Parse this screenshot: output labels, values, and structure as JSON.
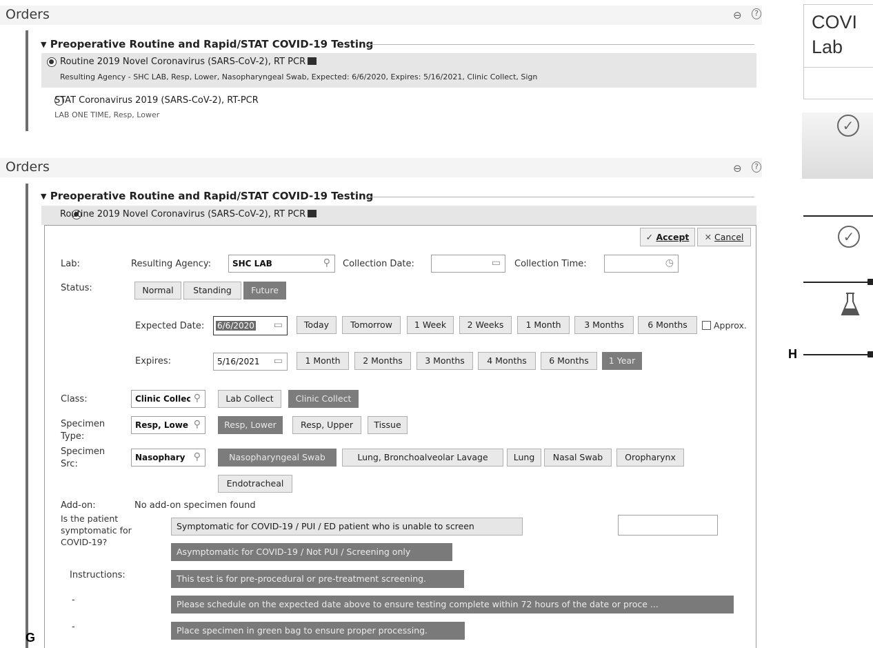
{
  "orders_top": {
    "title": "Orders",
    "more_icon": "⊖",
    "help_icon": "?",
    "group_title": "Preoperative Routine and Rapid/STAT COVID-19 Testing",
    "order1_name": "Routine 2019 Novel Coronavirus (SARS-CoV-2), RT PCR",
    "order1_detail": "Resulting Agency - SHC LAB, Resp, Lower, Nasopharyngeal Swab, Expected: 6/6/2020, Expires: 5/16/2021, Clinic Collect, Sign",
    "order2_name": "STAT Coronavirus 2019 (SARS-CoV-2), RT-PCR",
    "order2_detail": "LAB ONE TIME, Resp, Lower"
  },
  "orders_bottom": {
    "title": "Orders",
    "more_icon": "⊖",
    "help_icon": "?",
    "group_title": "Preoperative Routine and Rapid/STAT COVID-19 Testing",
    "order_name": "Routine 2019 Novel Coronavirus (SARS-CoV-2), RT PCR",
    "accept_label": "Accept",
    "cancel_label": "Cancel",
    "lab_label": "Lab:",
    "resulting_agency_label": "Resulting Agency:",
    "resulting_agency_value": "SHC LAB",
    "collection_date_label": "Collection Date:",
    "collection_date_value": "",
    "collection_time_label": "Collection Time:",
    "collection_time_value": "",
    "status_label": "Status:",
    "status_options": [
      "Normal",
      "Standing",
      "Future"
    ],
    "status_selected": "Future",
    "expected_date_label": "Expected Date:",
    "expected_date_value": "6/6/2020",
    "expected_quick": [
      "Today",
      "Tomorrow",
      "1 Week",
      "2 Weeks",
      "1 Month",
      "3 Months",
      "6 Months"
    ],
    "approx_label": "Approx.",
    "expires_label": "Expires:",
    "expires_value": "5/16/2021",
    "expires_quick": [
      "1 Month",
      "2 Months",
      "3 Months",
      "4 Months",
      "6 Months",
      "1 Year"
    ],
    "expires_selected": "1 Year",
    "class_label": "Class:",
    "class_value": "Clinic Collec",
    "class_options": [
      "Lab Collect",
      "Clinic Collect"
    ],
    "class_selected": "Clinic Collect",
    "specimen_type_label_1": "Specimen",
    "specimen_type_label_2": "Type:",
    "specimen_type_value": "Resp, Lowe",
    "specimen_type_options": [
      "Resp, Lower",
      "Resp, Upper",
      "Tissue"
    ],
    "specimen_type_selected": "Resp, Lower",
    "specimen_src_label_1": "Specimen",
    "specimen_src_label_2": "Src:",
    "specimen_src_value": "Nasophary",
    "specimen_src_options": [
      "Nasopharyngeal Swab",
      "Lung, Bronchoalveolar Lavage",
      "Lung",
      "Nasal Swab",
      "Oropharynx",
      "Endotracheal"
    ],
    "specimen_src_selected": "Nasopharyngeal Swab",
    "addon_label": "Add-on:",
    "addon_value": "No add-on specimen found",
    "question_label_1": "Is the patient",
    "question_label_2": "symptomatic for",
    "question_label_3": "COVID-19?",
    "question_options": [
      "Symptomatic for COVID-19 / PUI / ED patient who is unable to screen",
      "Asymptomatic for COVID-19 / Not PUI / Screening only"
    ],
    "question_selected": "Asymptomatic for COVID-19 / Not PUI / Screening only",
    "instructions_label": "Instructions:",
    "dash": "-",
    "instructions": [
      "This test is for pre-procedural or pre-treatment screening.",
      "Please schedule on the expected date above to ensure testing complete within 72 hours of the date or proce ...",
      "Place specimen in green bag to ensure proper processing."
    ]
  },
  "right_strip": {
    "header_line1": "COVI",
    "header_line2": "Lab",
    "check_icon": "✓",
    "flask_icon": "flask-icon"
  },
  "panel_letters": {
    "g": "G",
    "h": "H"
  }
}
